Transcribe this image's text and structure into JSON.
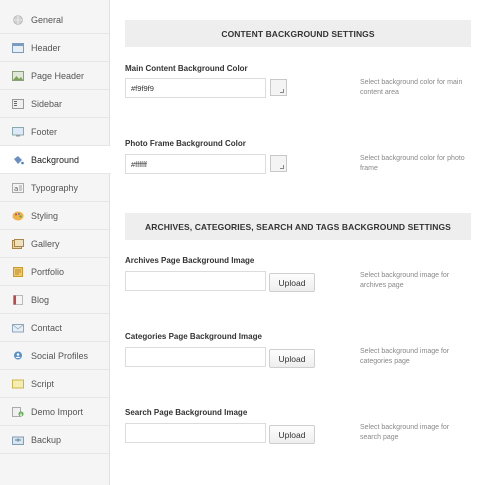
{
  "sidebar": {
    "items": [
      {
        "label": "General",
        "icon": "globe-icon"
      },
      {
        "label": "Header",
        "icon": "window-icon"
      },
      {
        "label": "Page Header",
        "icon": "image-icon"
      },
      {
        "label": "Sidebar",
        "icon": "columns-icon"
      },
      {
        "label": "Footer",
        "icon": "monitor-icon"
      },
      {
        "label": "Background",
        "icon": "paint-bucket-icon"
      },
      {
        "label": "Typography",
        "icon": "font-icon"
      },
      {
        "label": "Styling",
        "icon": "palette-icon"
      },
      {
        "label": "Gallery",
        "icon": "gallery-icon"
      },
      {
        "label": "Portfolio",
        "icon": "portfolio-icon"
      },
      {
        "label": "Blog",
        "icon": "book-icon"
      },
      {
        "label": "Contact",
        "icon": "envelope-icon"
      },
      {
        "label": "Social Profiles",
        "icon": "social-icon"
      },
      {
        "label": "Script",
        "icon": "script-icon"
      },
      {
        "label": "Demo Import",
        "icon": "import-icon"
      },
      {
        "label": "Backup",
        "icon": "backup-icon"
      }
    ],
    "active_index": 5
  },
  "content_section": {
    "title": "CONTENT BACKGROUND SETTINGS",
    "main_color": {
      "label": "Main Content Background Color",
      "value": "#f9f9f9",
      "description": "Select background color for main content area"
    },
    "photo_frame_color": {
      "label": "Photo Frame Background Color",
      "value": "#ffffff",
      "description": "Select background color for photo frame"
    }
  },
  "archives_section": {
    "title": "ARCHIVES, CATEGORIES, SEARCH AND TAGS BACKGROUND SETTINGS",
    "archives": {
      "label": "Archives Page Background Image",
      "value": "",
      "button": "Upload",
      "description": "Select background image for archives page"
    },
    "categories": {
      "label": "Categories Page Background Image",
      "value": "",
      "button": "Upload",
      "description": "Select background image for categories page"
    },
    "search": {
      "label": "Search Page Background Image",
      "value": "",
      "button": "Upload",
      "description": "Select background image for search page"
    }
  },
  "colors": {
    "sidebar_bg": "#f5f5f5",
    "section_header_bg": "#eeeeee",
    "description_text": "#888888"
  }
}
